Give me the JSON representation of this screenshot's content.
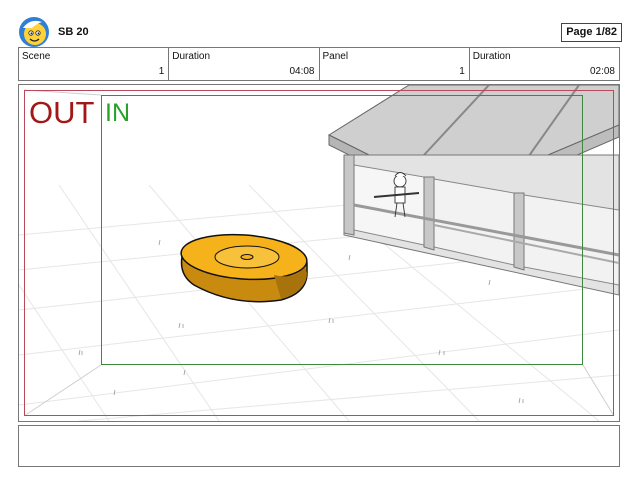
{
  "header": {
    "title": "SB 20",
    "page_label": "Page",
    "page_value": "1/82"
  },
  "info": {
    "scene_label": "Scene",
    "scene_value": "1",
    "scene_duration_label": "Duration",
    "scene_duration_value": "04:08",
    "panel_label": "Panel",
    "panel_value": "1",
    "panel_duration_label": "Duration",
    "panel_duration_value": "02:08"
  },
  "frames": {
    "out_label": "OUT",
    "in_label": "IN",
    "out_color": "#b84a5a",
    "in_color": "#3d8a3d",
    "out_text_color": "#a01818",
    "in_text_color": "#2aa02a"
  },
  "scene_colors": {
    "disc": "#f5b21a",
    "disc_shadow": "#c98a10",
    "building": "#d8d8d8",
    "building_dark": "#bdbdbd"
  },
  "notes": {
    "text": ""
  }
}
